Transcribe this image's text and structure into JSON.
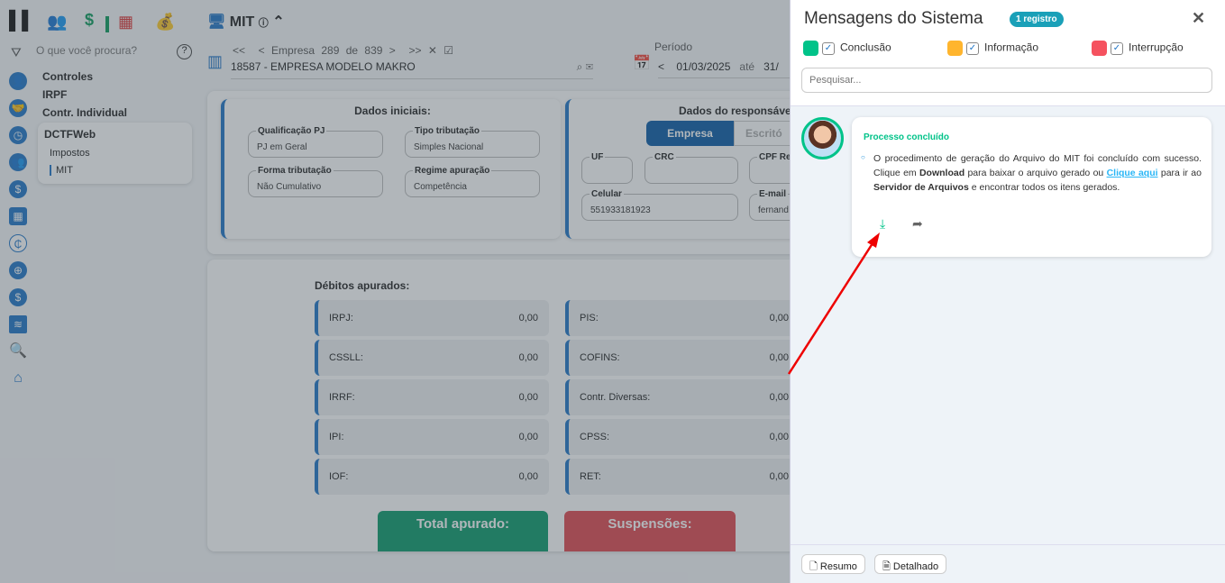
{
  "topbar": {
    "module_title": "MIT"
  },
  "sidebar": {
    "search_placeholder": "O que você procura?",
    "menu": [
      "Controles",
      "IRPF",
      "Contr. Individual"
    ],
    "group": {
      "title": "DCTFWeb",
      "items": [
        "Impostos",
        "MIT"
      ]
    }
  },
  "company": {
    "nav": "Empresa 289 de 839",
    "name": "18587 - EMPRESA MODELO MAKRO"
  },
  "period": {
    "label": "Período",
    "from": "01/03/2025",
    "sep": "até",
    "to": "31/"
  },
  "dados_iniciais": {
    "title": "Dados iniciais:",
    "fields": [
      {
        "label": "Qualificação PJ",
        "value": "PJ em Geral"
      },
      {
        "label": "Tipo tributação",
        "value": "Simples Nacional"
      },
      {
        "label": "Forma tributação",
        "value": "Não Cumulativo"
      },
      {
        "label": "Regime apuração",
        "value": "Competência"
      }
    ]
  },
  "responsavel": {
    "title": "Dados do responsáve",
    "tabs": [
      "Empresa",
      "Escritó"
    ],
    "fields": [
      {
        "label": "UF",
        "value": ""
      },
      {
        "label": "CRC",
        "value": ""
      },
      {
        "label": "CPF Res",
        "value": ""
      },
      {
        "label": "Celular",
        "value": "551933181923"
      },
      {
        "label": "E-mail",
        "value": "fernand"
      }
    ]
  },
  "debitos": {
    "title": "Débitos apurados:",
    "left": [
      {
        "label": "IRPJ:",
        "value": "0,00"
      },
      {
        "label": "CSSLL:",
        "value": "0,00"
      },
      {
        "label": "IRRF:",
        "value": "0,00"
      },
      {
        "label": "IPI:",
        "value": "0,00"
      },
      {
        "label": "IOF:",
        "value": "0,00"
      }
    ],
    "right": [
      {
        "label": "PIS:",
        "value": "0,00"
      },
      {
        "label": "COFINS:",
        "value": "0,00"
      },
      {
        "label": "Contr. Diversas:",
        "value": "0,00"
      },
      {
        "label": "CPSS:",
        "value": "0,00"
      },
      {
        "label": "RET:",
        "value": "0,00"
      }
    ],
    "total": "Total apurado:",
    "suspensoes": "Suspensões:"
  },
  "panel": {
    "title": "Mensagens do Sistema",
    "badge": "1 registro",
    "filters": [
      {
        "label": "Conclusão",
        "color": "#00c389"
      },
      {
        "label": "Informação",
        "color": "#ffb52e"
      },
      {
        "label": "Interrupção",
        "color": "#f5525f"
      }
    ],
    "search_placeholder": "Pesquisar...",
    "message": {
      "title": "Processo concluído",
      "t1": "O procedimento de geração do Arquivo do MIT foi concluído com sucesso. Clique em ",
      "b1": "Download",
      "t2": " para baixar o arquivo gerado ou ",
      "link": "Clique aqui",
      "t3": " para ir ao ",
      "b2": "Servidor de Arquivos",
      "t4": " e encontrar todos os itens gerados."
    },
    "footer": {
      "resumo": "Resumo",
      "detalhado": "Detalhado"
    }
  }
}
